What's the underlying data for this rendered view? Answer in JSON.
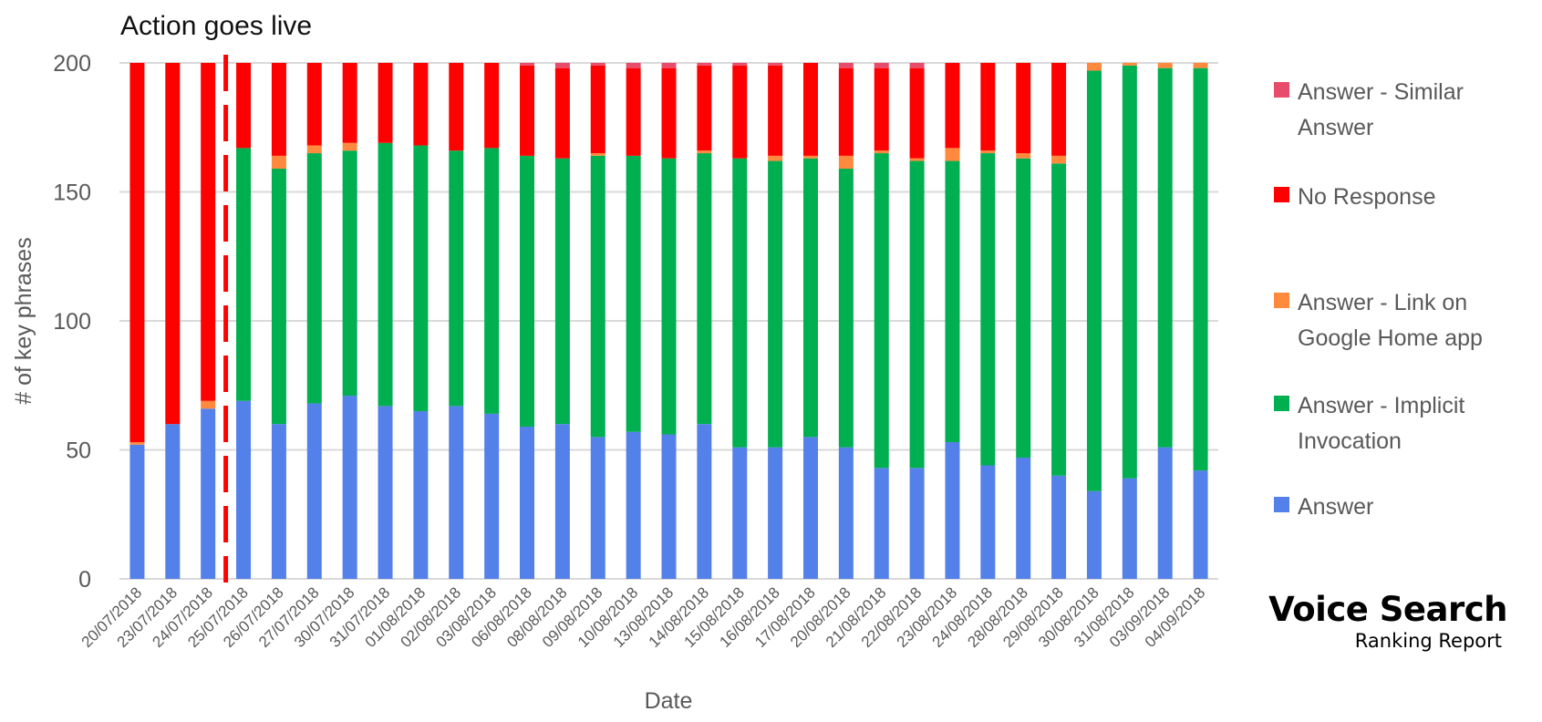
{
  "chart_data": {
    "type": "bar",
    "stacked": true,
    "title": "Action goes live",
    "xlabel": "Date",
    "ylabel": "# of key phrases",
    "ylim": [
      0,
      200
    ],
    "yticks": [
      0,
      50,
      100,
      150,
      200
    ],
    "grid": true,
    "legend_position": "right",
    "annotation": {
      "type": "vertical-dashed-line",
      "between": [
        "24/07/2018",
        "25/07/2018"
      ],
      "label": "Action goes live",
      "color": "#FF0000"
    },
    "categories": [
      "20/07/2018",
      "23/07/2018",
      "24/07/2018",
      "25/07/2018",
      "26/07/2018",
      "27/07/2018",
      "30/07/2018",
      "31/07/2018",
      "01/08/2018",
      "02/08/2018",
      "03/08/2018",
      "06/08/2018",
      "08/08/2018",
      "09/08/2018",
      "10/08/2018",
      "13/08/2018",
      "14/08/2018",
      "15/08/2018",
      "16/08/2018",
      "17/08/2018",
      "20/08/2018",
      "21/08/2018",
      "22/08/2018",
      "23/08/2018",
      "24/08/2018",
      "28/08/2018",
      "29/08/2018",
      "30/08/2018",
      "31/08/2018",
      "03/09/2018",
      "04/09/2018"
    ],
    "series": [
      {
        "name": "Answer",
        "color": "#5480EA",
        "values": [
          52,
          60,
          66,
          69,
          60,
          68,
          71,
          67,
          65,
          67,
          64,
          59,
          60,
          55,
          57,
          56,
          60,
          51,
          51,
          55,
          51,
          43,
          43,
          53,
          44,
          47,
          40,
          34,
          39,
          51,
          42
        ]
      },
      {
        "name": "Answer - Implicit Invocation",
        "color": "#00AF50",
        "values": [
          0,
          0,
          0,
          98,
          99,
          97,
          95,
          102,
          103,
          99,
          103,
          105,
          103,
          109,
          107,
          107,
          105,
          112,
          111,
          108,
          108,
          122,
          119,
          109,
          121,
          116,
          121,
          163,
          160,
          147,
          156
        ]
      },
      {
        "name": "Answer - Link on Google Home app",
        "color": "#FF8A3D",
        "values": [
          1,
          0,
          3,
          0,
          5,
          3,
          3,
          0,
          0,
          0,
          0,
          0,
          0,
          1,
          0,
          0,
          1,
          0,
          2,
          1,
          5,
          1,
          1,
          5,
          1,
          2,
          3,
          3,
          1,
          2,
          2
        ]
      },
      {
        "name": "No Response",
        "color": "#FF0000",
        "values": [
          147,
          140,
          131,
          33,
          36,
          32,
          31,
          31,
          32,
          34,
          33,
          35,
          35,
          34,
          34,
          35,
          33,
          36,
          35,
          36,
          34,
          32,
          35,
          33,
          34,
          35,
          36,
          0,
          0,
          0,
          0
        ]
      },
      {
        "name": "Answer - Similar Answer",
        "color": "#E84C6A",
        "values": [
          0,
          0,
          0,
          0,
          0,
          0,
          0,
          0,
          0,
          0,
          0,
          1,
          2,
          1,
          2,
          2,
          1,
          1,
          1,
          0,
          2,
          2,
          2,
          0,
          0,
          0,
          0,
          0,
          0,
          0,
          0
        ]
      }
    ]
  },
  "legend": {
    "items": [
      {
        "label": "Answer - Similar Answer",
        "color": "#E84C6A"
      },
      {
        "label": "No Response",
        "color": "#FF0000"
      },
      {
        "label": "Answer - Link on Google Home app",
        "color": "#FF8A3D"
      },
      {
        "label": "Answer - Implicit Invocation",
        "color": "#00AF50"
      },
      {
        "label": "Answer",
        "color": "#5480EA"
      }
    ]
  },
  "logo": {
    "main": "Voice Search",
    "sub": "Ranking Report"
  }
}
